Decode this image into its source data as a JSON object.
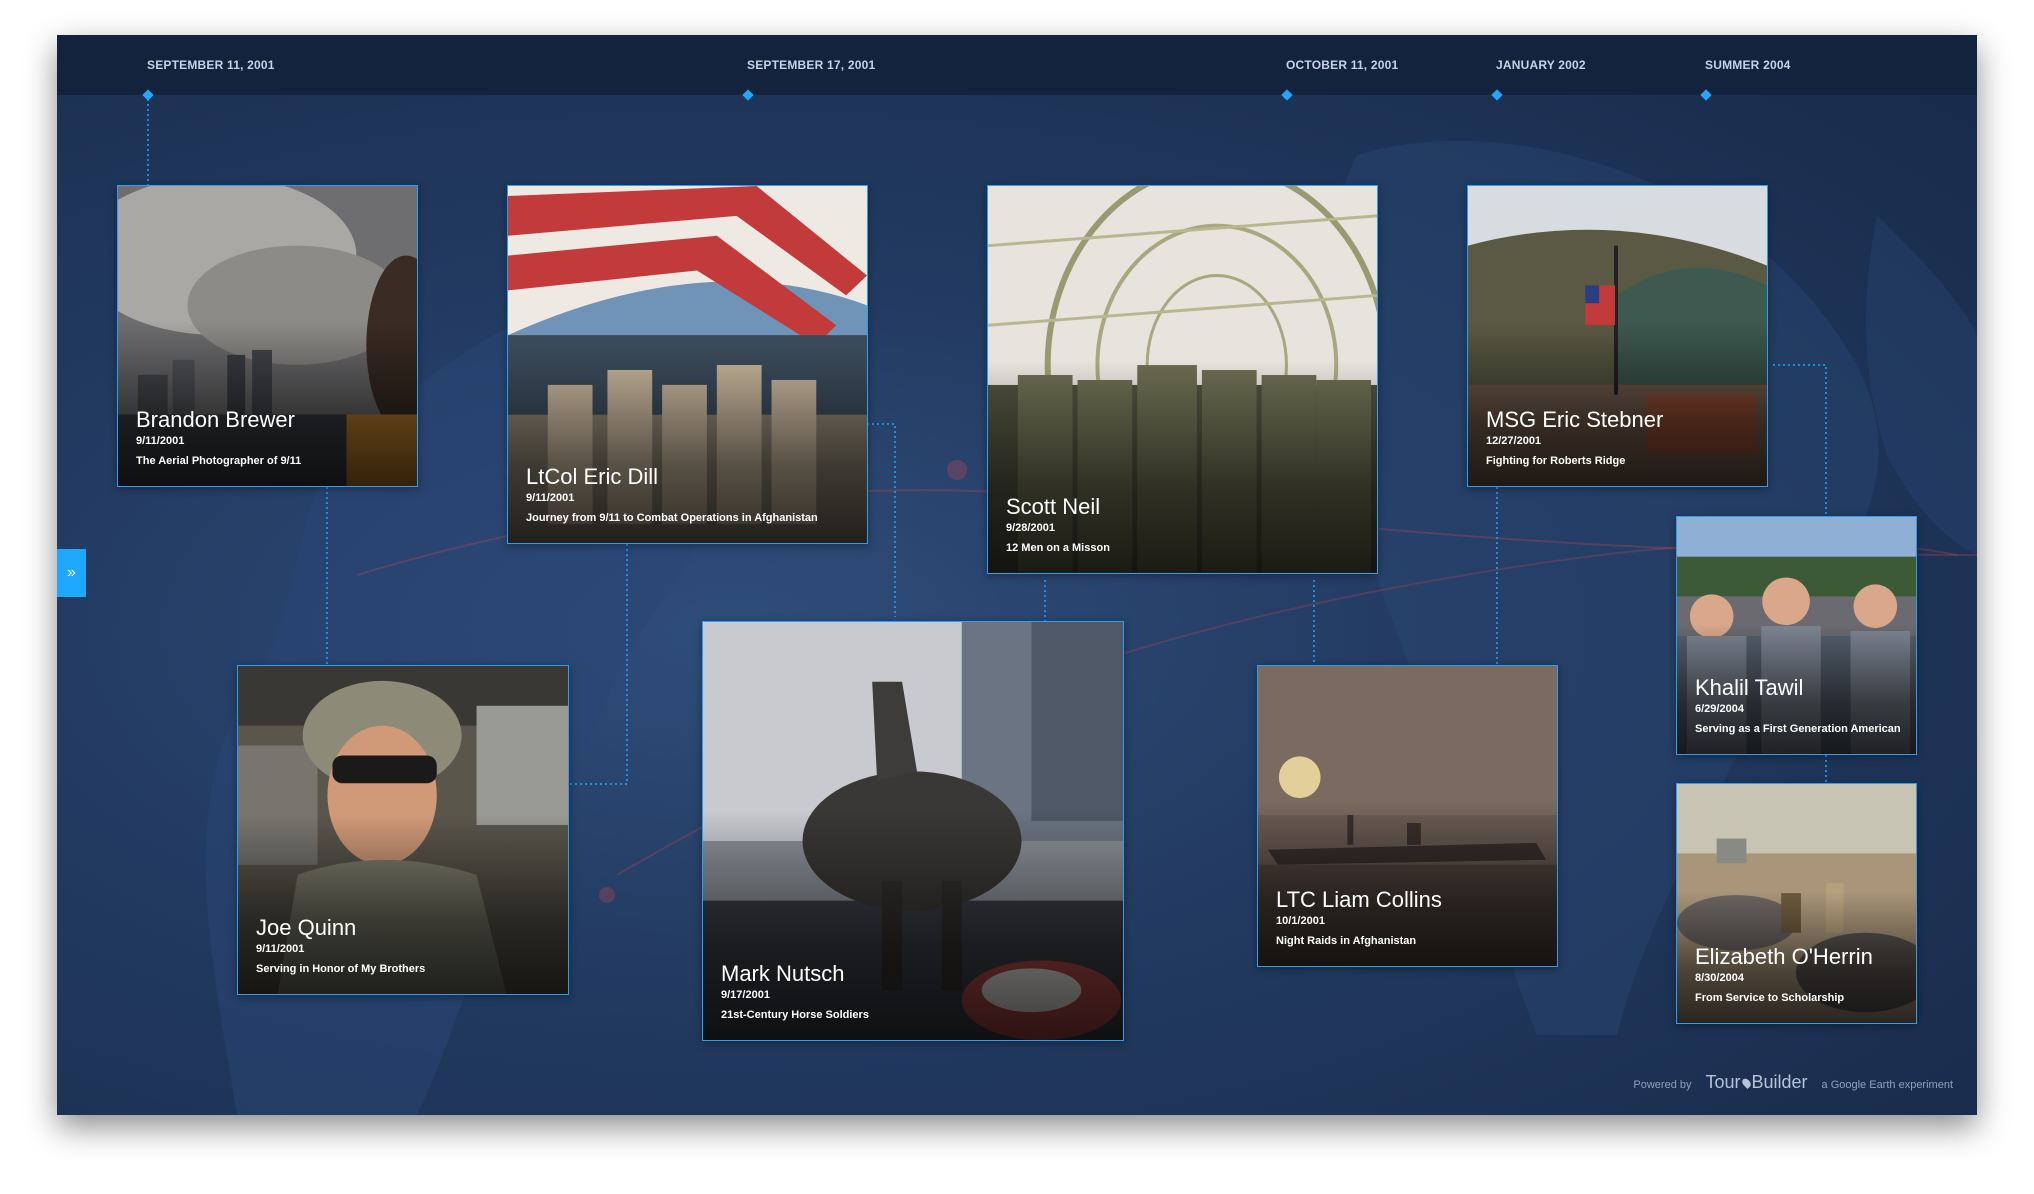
{
  "timeline": [
    {
      "label": "SEPTEMBER 11, 2001"
    },
    {
      "label": "SEPTEMBER 17, 2001"
    },
    {
      "label": "OCTOBER 11, 2001"
    },
    {
      "label": "JANUARY 2002"
    },
    {
      "label": "SUMMER 2004"
    }
  ],
  "stories": [
    {
      "name": "Brandon Brewer",
      "date": "9/11/2001",
      "subtitle": "The Aerial Photographer of 9/11"
    },
    {
      "name": "LtCol Eric Dill",
      "date": "9/11/2001",
      "subtitle": "Journey from 9/11 to Combat Operations in Afghanistan"
    },
    {
      "name": "Scott Neil",
      "date": "9/28/2001",
      "subtitle": "12 Men on a Misson"
    },
    {
      "name": "MSG Eric Stebner",
      "date": "12/27/2001",
      "subtitle": "Fighting for Roberts Ridge"
    },
    {
      "name": "Khalil Tawil",
      "date": "6/29/2004",
      "subtitle": "Serving as a First Generation American"
    },
    {
      "name": "Joe Quinn",
      "date": "9/11/2001",
      "subtitle": "Serving in Honor of My Brothers"
    },
    {
      "name": "Mark Nutsch",
      "date": "9/17/2001",
      "subtitle": "21st-Century Horse Soldiers"
    },
    {
      "name": "LTC Liam Collins",
      "date": "10/1/2001",
      "subtitle": "Night Raids in Afghanistan"
    },
    {
      "name": "Elizabeth O'Herrin",
      "date": "8/30/2004",
      "subtitle": "From Service to Scholarship"
    }
  ],
  "sidebar_toggle": {
    "label": "»",
    "icon": "double-chevron-right-icon"
  },
  "footer": {
    "powered_by": "Powered by",
    "brand_left": "Tour",
    "brand_right": "Builder",
    "brand_icon": "map-pin-icon",
    "experiment": "a Google Earth experiment"
  },
  "colors": {
    "accent": "#1fa8ff",
    "card_border": "#2aa1ef",
    "timeline_bar": "#13233d",
    "background": "#233b62"
  }
}
